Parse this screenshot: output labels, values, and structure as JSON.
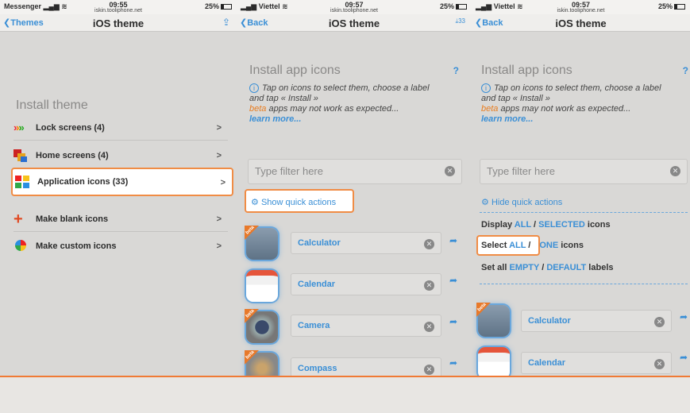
{
  "panel1": {
    "status": {
      "carrier": "Messenger",
      "time": "09:55",
      "url": "iskin.tooliphone.net",
      "battery": "25%"
    },
    "nav": {
      "back": "Themes",
      "title": "iOS theme"
    },
    "heading": "Install theme",
    "items": [
      {
        "label": "Lock screens (4)"
      },
      {
        "label": "Home screens (4)"
      },
      {
        "label": "Application icons (33)"
      },
      {
        "label": "Make blank icons"
      },
      {
        "label": "Make custom icons"
      }
    ]
  },
  "panel2": {
    "status": {
      "carrier": "Viettel",
      "time": "09:57",
      "url": "iskin.tooliphone.net",
      "battery": "25%"
    },
    "nav": {
      "back": "Back",
      "title": "iOS theme",
      "badge": "33"
    },
    "heading": "Install app icons",
    "help": "?",
    "info": {
      "line1": "Tap on icons to select them, choose a label",
      "line2": "and tap « Install »",
      "beta": "beta",
      "beta_text": " apps may not work as expected...",
      "more": "learn more..."
    },
    "filter_placeholder": "Type filter here",
    "quick_actions": "Show quick actions",
    "apps": [
      {
        "label": "Calculator"
      },
      {
        "label": "Calendar"
      },
      {
        "label": "Camera"
      },
      {
        "label": "Compass"
      }
    ],
    "beta_badge": "beta"
  },
  "panel3": {
    "status": {
      "carrier": "Viettel",
      "time": "09:57",
      "url": "iskin.tooliphone.net",
      "battery": "25%"
    },
    "nav": {
      "back": "Back",
      "title": "iOS theme"
    },
    "heading": "Install app icons",
    "help": "?",
    "info": {
      "line1": "Tap on icons to select them, choose a label",
      "line2": "and tap « Install »",
      "beta": "beta",
      "beta_text": " apps may not work as expected...",
      "more": "learn more..."
    },
    "filter_placeholder": "Type filter here",
    "quick_actions": "Hide quick actions",
    "display": {
      "prefix": "Display ",
      "all": "ALL",
      "slash": " / ",
      "selected": "SELECTED",
      "suffix": " icons"
    },
    "select": {
      "prefix": "Select ",
      "all": "ALL",
      "slash": " / ",
      "none": "NONE",
      "suffix": " icons"
    },
    "setall": {
      "prefix": "Set all ",
      "empty": "EMPTY",
      "slash": " / ",
      "default": "DEFAULT",
      "suffix": " labels"
    },
    "apps": [
      {
        "label": "Calculator"
      },
      {
        "label": "Calendar"
      }
    ]
  }
}
